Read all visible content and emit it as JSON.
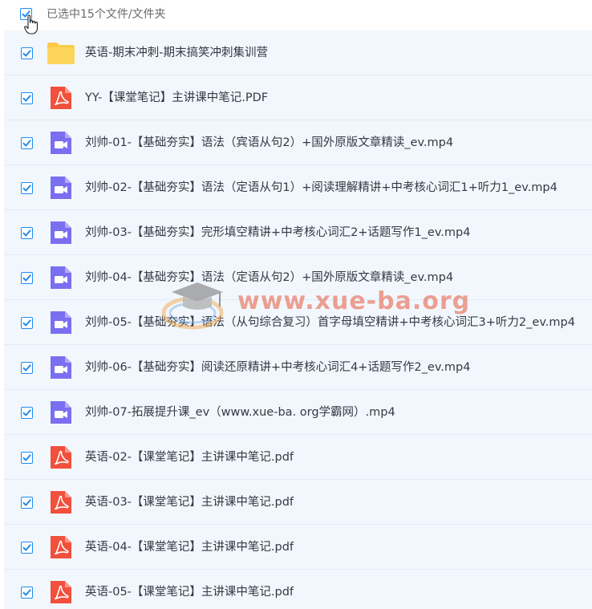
{
  "header": {
    "selection_text": "已选中15个文件/文件夹",
    "select_all_checked": true
  },
  "colors": {
    "accent": "#1e8cf0",
    "row_bg": "#f2f7fd",
    "folder": "#fbcb49",
    "pdf": "#f0503c",
    "video": "#7a6ff0",
    "watermark": "#e8654a"
  },
  "watermark": {
    "text": "www.xue-ba.org"
  },
  "files": [
    {
      "name": "英语-期末冲刺-期末搞笑冲刺集训营",
      "type": "folder",
      "icon": "folder-icon",
      "checked": true
    },
    {
      "name": "YY-【课堂笔记】主讲课中笔记.PDF",
      "type": "pdf",
      "icon": "pdf-icon",
      "checked": true
    },
    {
      "name": "刘帅-01-【基础夯实】语法（宾语从句2）+国外原版文章精读_ev.mp4",
      "type": "video",
      "icon": "video-icon",
      "checked": true
    },
    {
      "name": "刘帅-02-【基础夯实】语法（定语从句1）+阅读理解精讲+中考核心词汇1+听力1_ev.mp4",
      "type": "video",
      "icon": "video-icon",
      "checked": true
    },
    {
      "name": "刘帅-03-【基础夯实】完形填空精讲+中考核心词汇2+话题写作1_ev.mp4",
      "type": "video",
      "icon": "video-icon",
      "checked": true
    },
    {
      "name": "刘帅-04-【基础夯实】语法（定语从句2）+国外原版文章精读_ev.mp4",
      "type": "video",
      "icon": "video-icon",
      "checked": true
    },
    {
      "name": "刘帅-05-【基础夯实】语法（从句综合复习）首字母填空精讲+中考核心词汇3+听力2_ev.mp4",
      "type": "video",
      "icon": "video-icon",
      "checked": true
    },
    {
      "name": "刘帅-06-【基础夯实】阅读还原精讲+中考核心词汇4+话题写作2_ev.mp4",
      "type": "video",
      "icon": "video-icon",
      "checked": true
    },
    {
      "name": "刘帅-07-拓展提升课_ev（www.xue-ba. org学霸网）.mp4",
      "type": "video",
      "icon": "video-icon",
      "checked": true
    },
    {
      "name": "英语-02-【课堂笔记】主讲课中笔记.pdf",
      "type": "pdf",
      "icon": "pdf-icon",
      "checked": true
    },
    {
      "name": "英语-03-【课堂笔记】主讲课中笔记.pdf",
      "type": "pdf",
      "icon": "pdf-icon",
      "checked": true
    },
    {
      "name": "英语-04-【课堂笔记】主讲课中笔记.pdf",
      "type": "pdf",
      "icon": "pdf-icon",
      "checked": true
    },
    {
      "name": "英语-05-【课堂笔记】主讲课中笔记.pdf",
      "type": "pdf",
      "icon": "pdf-icon",
      "checked": true
    }
  ]
}
